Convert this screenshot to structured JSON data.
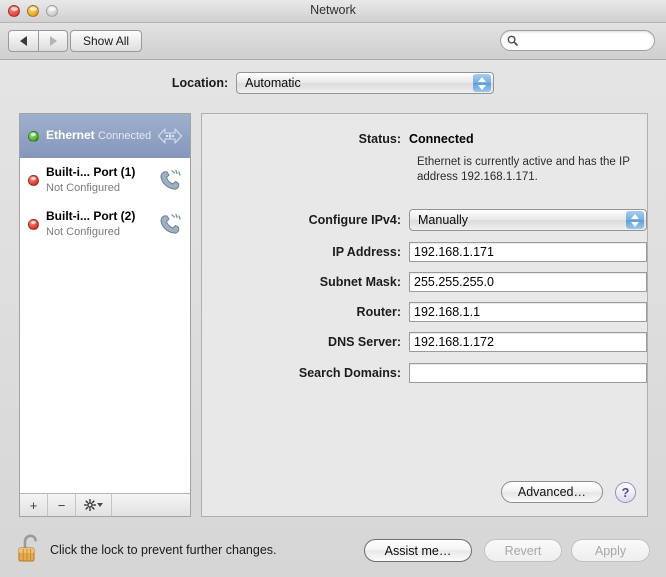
{
  "window": {
    "title": "Network",
    "traffic_lights": [
      "close",
      "minimize",
      "zoom"
    ]
  },
  "toolbar": {
    "back_icon": "triangle-left-icon",
    "forward_icon": "triangle-right-icon",
    "show_all_label": "Show All",
    "search_value": "",
    "search_placeholder": ""
  },
  "location": {
    "label": "Location:",
    "selected": "Automatic"
  },
  "sidebar": {
    "interfaces": [
      {
        "name": "Ethernet",
        "status": "Connected",
        "dot": "green",
        "icon": "ethernet-icon",
        "selected": true
      },
      {
        "name": "Built-i... Port (1)",
        "status": "Not Configured",
        "dot": "red",
        "icon": "modem-icon",
        "selected": false
      },
      {
        "name": "Built-i... Port (2)",
        "status": "Not Configured",
        "dot": "red",
        "icon": "modem-icon",
        "selected": false
      }
    ],
    "footer": {
      "add_label": "+",
      "remove_label": "−",
      "gear_icon": "gear-icon"
    }
  },
  "detail": {
    "status_label": "Status:",
    "status_value": "Connected",
    "status_description": "Ethernet is currently active and has the IP address 192.168.1.171.",
    "configure_label": "Configure IPv4:",
    "configure_value": "Manually",
    "fields": [
      {
        "label": "IP Address:",
        "value": "192.168.1.171"
      },
      {
        "label": "Subnet Mask:",
        "value": "255.255.255.0"
      },
      {
        "label": "Router:",
        "value": "192.168.1.1"
      },
      {
        "label": "DNS Server:",
        "value": "192.168.1.172"
      },
      {
        "label": "Search Domains:",
        "value": ""
      }
    ],
    "advanced_label": "Advanced…",
    "help_label": "?"
  },
  "bottom": {
    "lock_icon": "unlocked-padlock-icon",
    "lock_note": "Click the lock to prevent further changes.",
    "assist_label": "Assist me…",
    "revert_label": "Revert",
    "apply_label": "Apply",
    "revert_enabled": false,
    "apply_enabled": false
  },
  "colors": {
    "selection_blue": "#8496bb",
    "status_green": "#2f9e1e",
    "status_red": "#cf2a1e",
    "help_purple": "#5b4d93",
    "lock_gold": "#d89a3e"
  }
}
